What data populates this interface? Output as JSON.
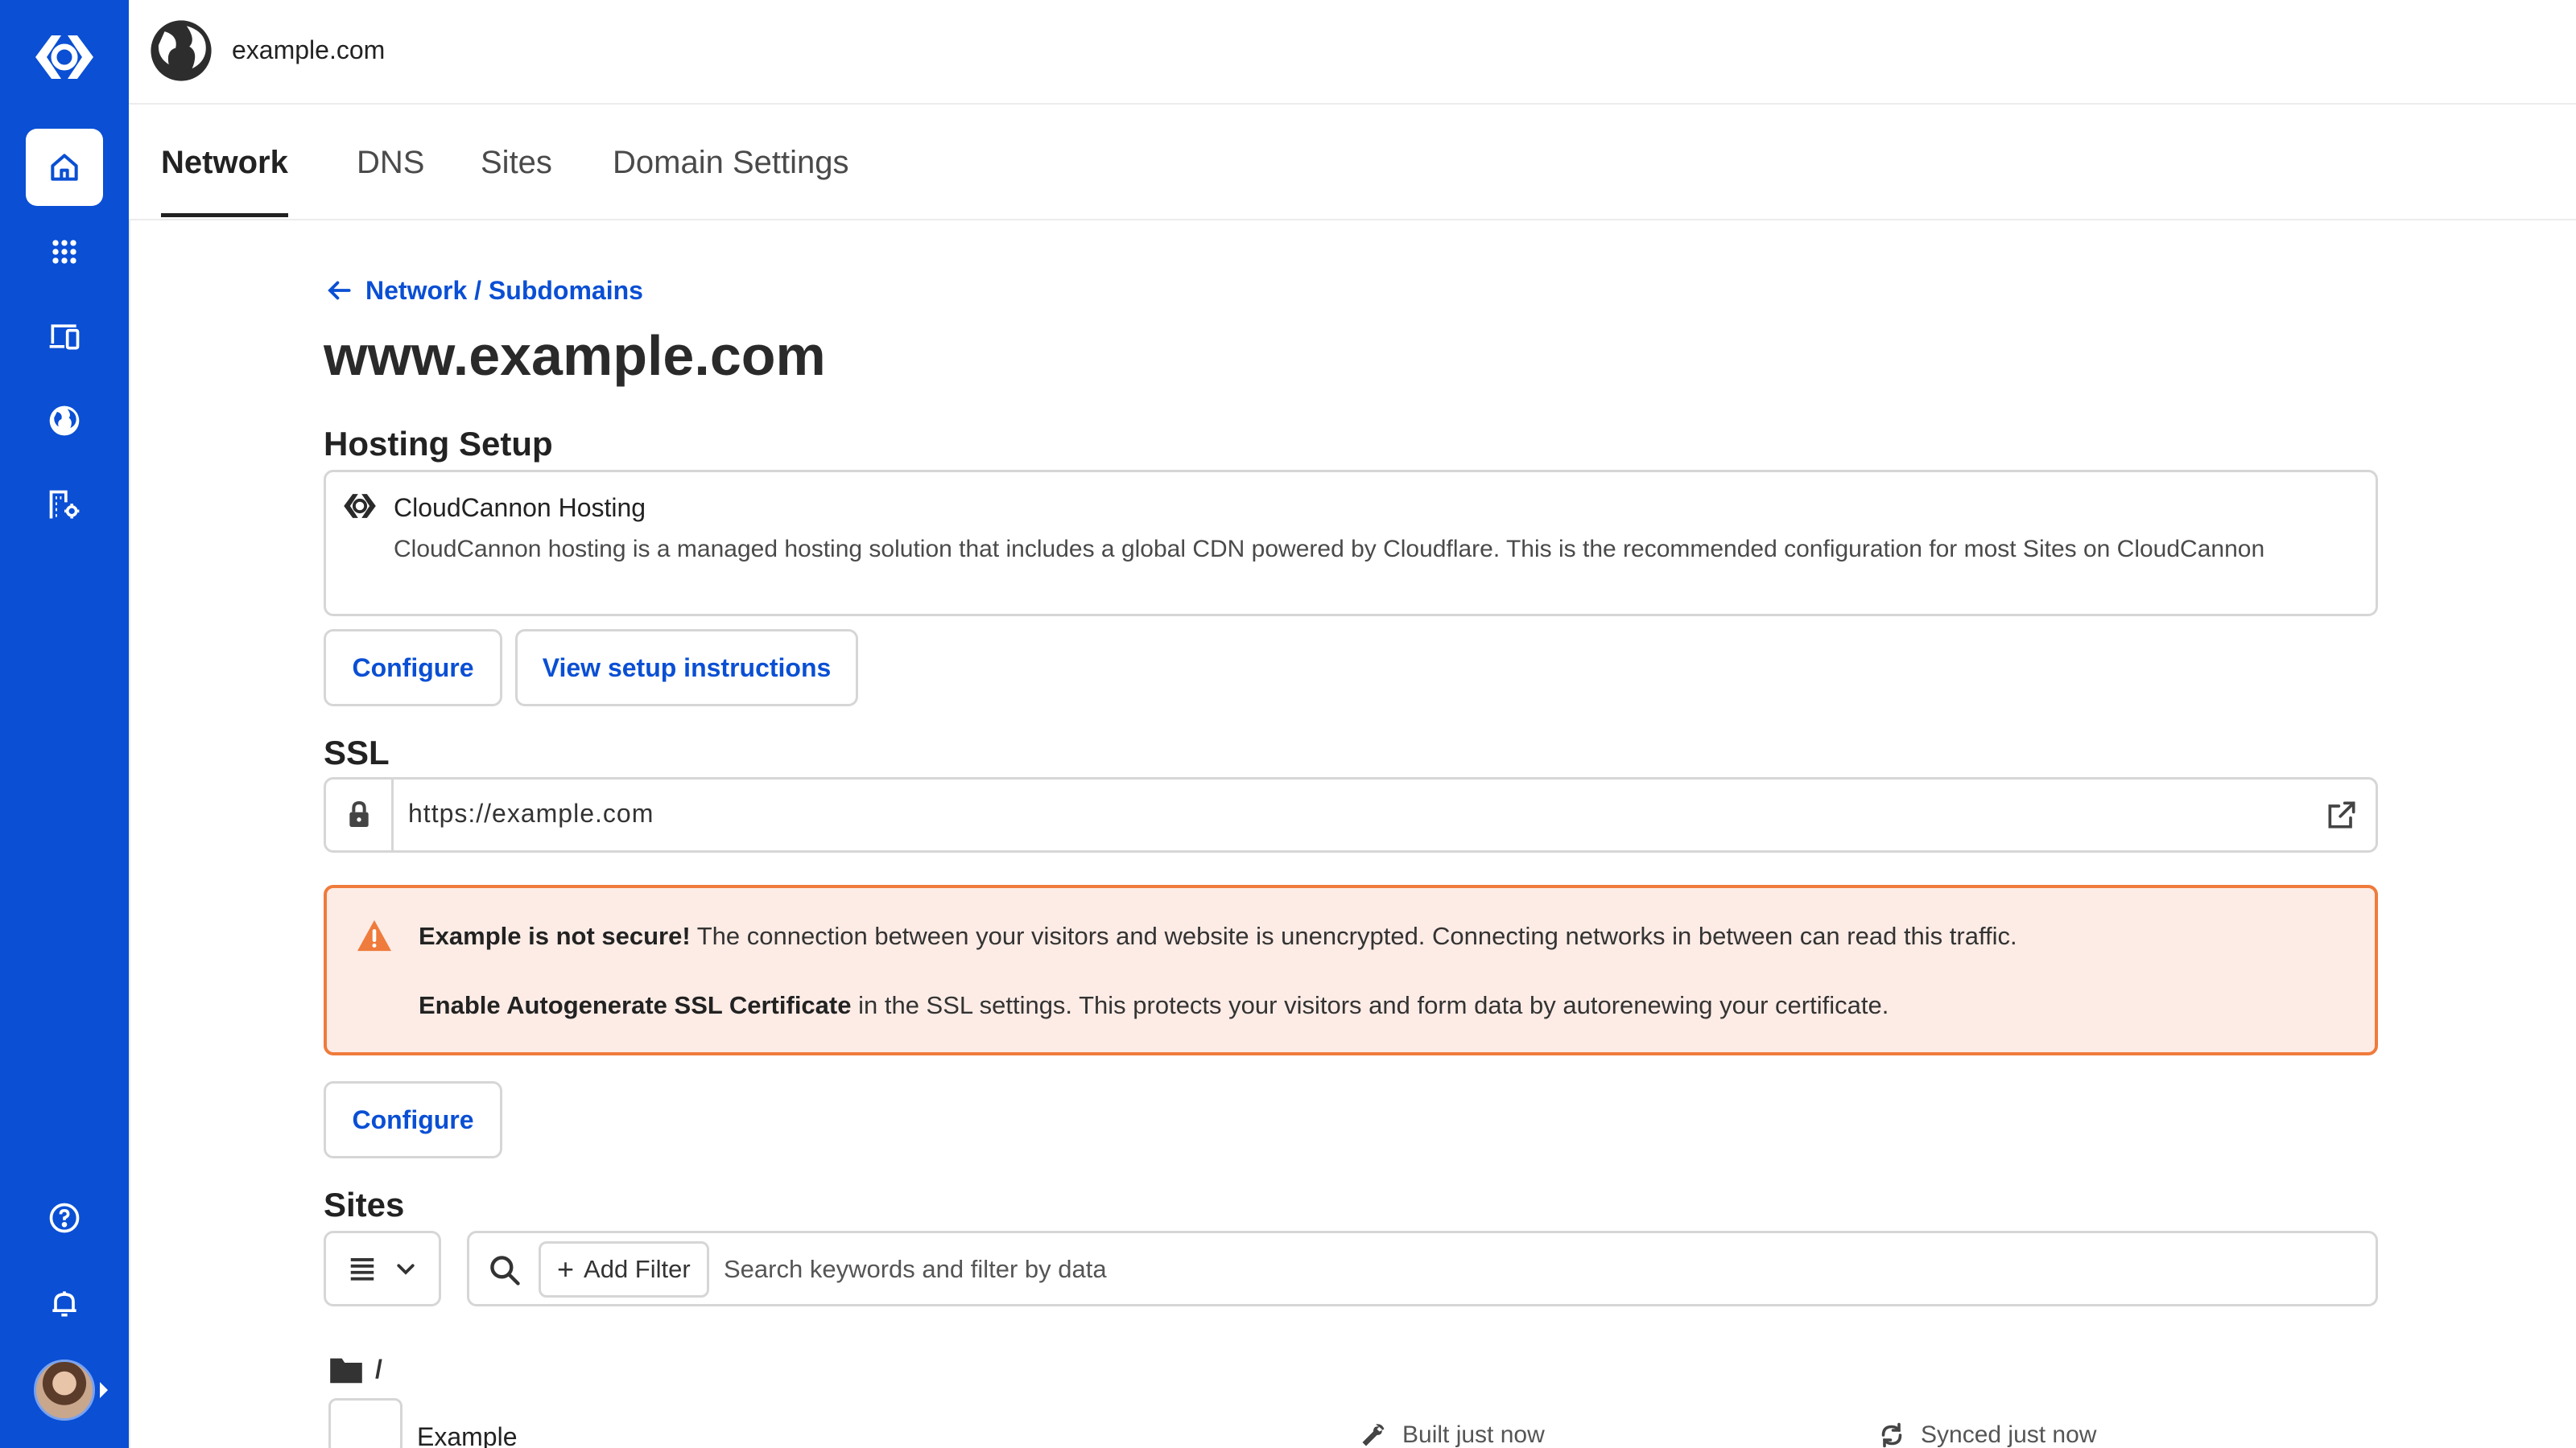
{
  "topbar": {
    "site_name": "example.com"
  },
  "tabs": [
    {
      "label": "Network"
    },
    {
      "label": "DNS"
    },
    {
      "label": "Sites"
    },
    {
      "label": "Domain Settings"
    }
  ],
  "breadcrumb": {
    "label": "Network / Subdomains"
  },
  "page": {
    "title": "www.example.com"
  },
  "hosting": {
    "section_title": "Hosting Setup",
    "card_title": "CloudCannon Hosting",
    "card_desc": "CloudCannon hosting is a managed hosting solution that includes a global CDN powered by Cloudflare. This is the recommended configuration for most Sites on CloudCannon",
    "configure_label": "Configure",
    "instructions_label": "View setup instructions"
  },
  "ssl": {
    "section_title": "SSL",
    "url": "https://example.com",
    "alert_bold_1": "Example is not secure!",
    "alert_text_1": " The connection between your visitors and website is unencrypted. Connecting networks in between can read this traffic.",
    "alert_bold_2": "Enable Autogenerate SSL Certificate",
    "alert_text_2": " in the SSL settings. This protects your visitors and form data by autorenewing your certificate.",
    "configure_label": "Configure"
  },
  "sites": {
    "section_title": "Sites",
    "add_filter_label": "Add Filter",
    "search_placeholder": "Search keywords and filter by data",
    "folder_path": "/",
    "rows": [
      {
        "name": "Example",
        "built": "Built just now",
        "synced": "Synced just now"
      }
    ]
  },
  "colors": {
    "brand": "#0a4fd4",
    "warning_border": "#ef7b3c",
    "warning_bg": "#fdece6"
  },
  "icons": [
    "cloudcannon-logo-icon",
    "home-icon",
    "apps-grid-icon",
    "devices-icon",
    "globe-icon",
    "building-settings-icon",
    "help-icon",
    "bell-icon",
    "lock-icon",
    "external-link-icon",
    "warning-icon",
    "search-icon",
    "list-icon",
    "chevron-down-icon",
    "folder-icon",
    "wrench-icon",
    "sync-icon"
  ]
}
